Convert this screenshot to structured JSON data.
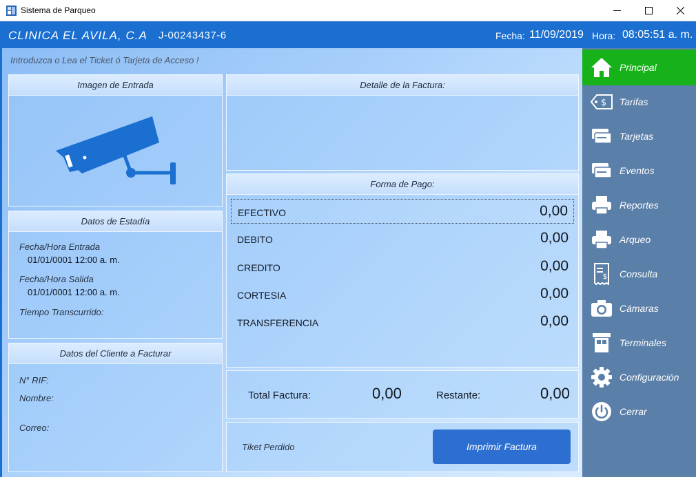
{
  "window": {
    "title": "Sistema de Parqueo"
  },
  "header": {
    "company": "CLINICA EL AVILA, C.A",
    "rif": "J-00243437-6",
    "fecha_label": "Fecha:",
    "fecha_value": "11/09/2019",
    "hora_label": "Hora:",
    "hora_value": "08:05:51 a. m."
  },
  "prompt": "Introduzca o Lea el Ticket ó Tarjeta de Acceso !",
  "imagen_panel": {
    "title": "Imagen de Entrada",
    "icon": "security-camera-icon"
  },
  "estadia": {
    "title": "Datos de Estadía",
    "entrada_label": "Fecha/Hora Entrada",
    "entrada_value": "01/01/0001 12:00 a. m.",
    "salida_label": "Fecha/Hora Salida",
    "salida_value": "01/01/0001 12:00 a. m.",
    "tiempo_label": "Tiempo Transcurrido:"
  },
  "cliente": {
    "title": "Datos del Cliente a Facturar",
    "rif_label": "N° RIF:",
    "nombre_label": "Nombre:",
    "correo_label": "Correo:"
  },
  "detalle": {
    "title": "Detalle de la Factura:"
  },
  "pago": {
    "title": "Forma de Pago:",
    "rows": [
      {
        "name": "EFECTIVO",
        "amount": "0,00"
      },
      {
        "name": "DEBITO",
        "amount": "0,00"
      },
      {
        "name": "CREDITO",
        "amount": "0,00"
      },
      {
        "name": "CORTESIA",
        "amount": "0,00"
      },
      {
        "name": "TRANSFERENCIA",
        "amount": "0,00"
      }
    ]
  },
  "totales": {
    "total_label": "Total Factura:",
    "total_value": "0,00",
    "restante_label": "Restante:",
    "restante_value": "0,00"
  },
  "acciones": {
    "perdido_label": "Tiket Perdido",
    "imprimir_label": "Imprimir Factura"
  },
  "sidebar": {
    "items": [
      {
        "label": "Principal",
        "icon": "home-icon",
        "active": true
      },
      {
        "label": "Tarifas",
        "icon": "price-tag-icon"
      },
      {
        "label": "Tarjetas",
        "icon": "cards-icon"
      },
      {
        "label": "Eventos",
        "icon": "cards-icon"
      },
      {
        "label": "Reportes",
        "icon": "printer-icon"
      },
      {
        "label": "Arqueo",
        "icon": "printer-icon"
      },
      {
        "label": "Consulta",
        "icon": "receipt-icon"
      },
      {
        "label": "Cámaras",
        "icon": "camera-icon"
      },
      {
        "label": "Terminales",
        "icon": "booth-icon"
      },
      {
        "label": "Configuración",
        "icon": "gear-icon"
      },
      {
        "label": "Cerrar",
        "icon": "power-icon"
      }
    ]
  },
  "colors": {
    "header_bg": "#1a6fd0",
    "sidebar_bg": "#5a7fa8",
    "active_item": "#17b21a",
    "button_bg": "#2d6ed1"
  }
}
